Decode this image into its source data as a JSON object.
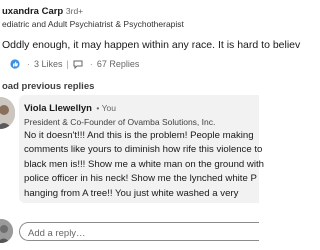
{
  "parent_comment": {
    "author": "uxandra Carp",
    "degree": "3rd+",
    "headline": "ediatric and Adult Psychiatrist & Psychotherapist",
    "text": "Oddly enough, it may happen within any race. It is hard to believ",
    "likes": "3 Likes",
    "replies": "67 Replies"
  },
  "load_previous": "oad previous replies",
  "reply": {
    "author": "Viola Llewellyn",
    "degree": "• You",
    "headline": "President & Co-Founder of Ovamba Solutions, Inc.",
    "lines": [
      "No it doesn't!!!  And this is the problem!  People making",
      "comments like yours to diminish how rife this violence to",
      "black men is!!!  Show me a white man on the ground with",
      "police officer in his neck!  Show me the lynched white P",
      "hanging from A tree!!  You just white washed a very"
    ]
  },
  "add_reply": {
    "placeholder": "Add a reply…"
  },
  "colors": {
    "text": "#191919",
    "muted": "#666666",
    "bubble": "#f2f2f2",
    "border": "#8c8c8c"
  }
}
